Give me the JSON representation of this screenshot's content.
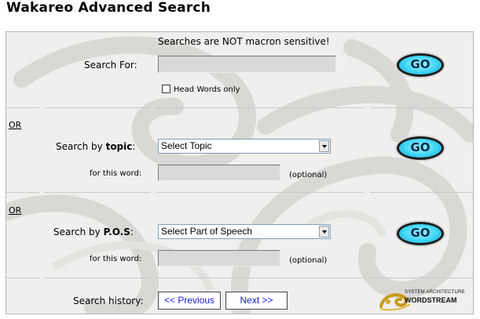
{
  "page": {
    "title": "Wakareo Advanced Search"
  },
  "notice": "Searches are NOT macron sensitive!",
  "search_for": {
    "label": "Search For:",
    "value": "",
    "head_words_label": "Head Words only",
    "head_words_checked": false,
    "go_label": "GO"
  },
  "topic": {
    "or_label": "OR",
    "label_prefix": "Search by ",
    "label_bold": "topic",
    "label_suffix": ":",
    "select_value": "Select Topic",
    "word_label": "for this word:",
    "word_value": "",
    "optional": "(optional)",
    "go_label": "GO"
  },
  "pos": {
    "or_label": "OR",
    "label_prefix": "Search by ",
    "label_bold": "P.O.S",
    "label_suffix": ":",
    "select_value": "Select Part of Speech",
    "word_label": "for this word:",
    "word_value": "",
    "optional": "(optional)",
    "go_label": "GO"
  },
  "history": {
    "label": "Search history:",
    "previous": "<< Previous",
    "next": "Next >>"
  },
  "logo": {
    "line1": "SYSTEM ARCHITECTURE",
    "line2": "WORDSTREAM"
  },
  "colors": {
    "panel": "#f0efed",
    "go_button": "#3ed5f5",
    "nav_link": "#1a1ae0"
  }
}
